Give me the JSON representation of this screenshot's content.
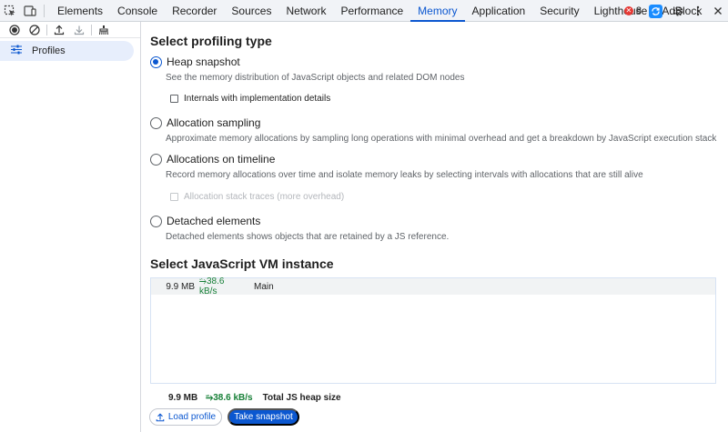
{
  "tabs": [
    {
      "label": "Elements"
    },
    {
      "label": "Console"
    },
    {
      "label": "Recorder"
    },
    {
      "label": "Sources"
    },
    {
      "label": "Network"
    },
    {
      "label": "Performance"
    },
    {
      "label": "Memory",
      "active": true
    },
    {
      "label": "Application"
    },
    {
      "label": "Security"
    },
    {
      "label": "Lighthouse"
    },
    {
      "label": "AdBlock"
    }
  ],
  "status": {
    "error_count": "8"
  },
  "sidebar": {
    "profiles_label": "Profiles"
  },
  "profiling": {
    "heading": "Select profiling type",
    "options": [
      {
        "label": "Heap snapshot",
        "selected": true,
        "description": "See the memory distribution of JavaScript objects and related DOM nodes"
      },
      {
        "label": "Allocation sampling",
        "selected": false,
        "description": "Approximate memory allocations by sampling long operations with minimal overhead and get a breakdown by JavaScript execution stack"
      },
      {
        "label": "Allocations on timeline",
        "selected": false,
        "description": "Record memory allocations over time and isolate memory leaks by selecting intervals with allocations that are still alive"
      },
      {
        "label": "Detached elements",
        "selected": false,
        "description": "Detached elements shows objects that are retained by a JS reference."
      }
    ],
    "internals_checkbox": "Internals with implementation details",
    "allocation_stack_checkbox": "Allocation stack traces (more overhead)"
  },
  "vm": {
    "heading": "Select JavaScript VM instance",
    "rows": [
      {
        "size": "9.9 MB",
        "rate": "⭇38.6 kB/s",
        "name": "Main"
      }
    ]
  },
  "footer": {
    "total_size": "9.9 MB",
    "total_rate": "⭇38.6 kB/s",
    "total_label": "Total JS heap size",
    "load_button": "Load profile",
    "snapshot_button": "Take snapshot"
  },
  "colors": {
    "accent": "#0b57d0",
    "rate_green": "#188038",
    "error_red": "#e53935"
  }
}
